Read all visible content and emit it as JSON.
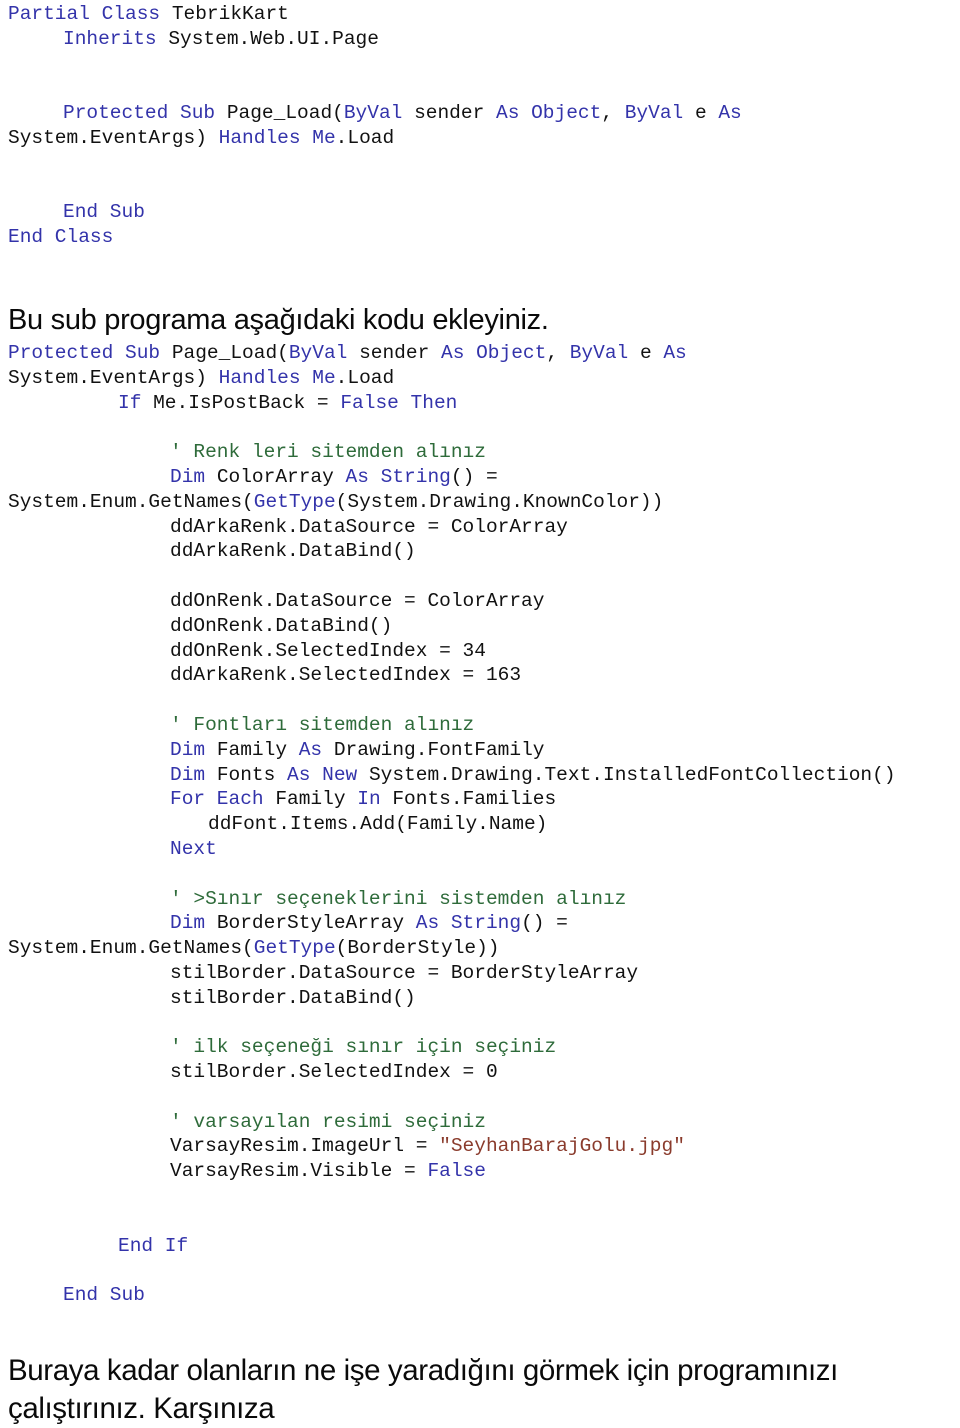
{
  "document": {
    "language": "tr",
    "colors": {
      "keyword": "#3333aa",
      "comment": "#2e6b3a",
      "string": "#8a3b2c",
      "plain": "#111111",
      "background": "#ffffff"
    }
  },
  "block_header": {
    "lines": [
      {
        "indent": 0,
        "parts": [
          {
            "t": "Partial Class ",
            "c": "kw"
          },
          {
            "t": "TebrikKart",
            "c": "pln"
          }
        ]
      },
      {
        "indent": 1,
        "parts": [
          {
            "t": "Inherits ",
            "c": "kw"
          },
          {
            "t": "System.Web.UI.Page",
            "c": "pln"
          }
        ]
      },
      {
        "indent": 0,
        "parts": []
      },
      {
        "indent": 0,
        "parts": []
      },
      {
        "indent": 1,
        "parts": [
          {
            "t": "Protected Sub ",
            "c": "kw"
          },
          {
            "t": "Page_Load(",
            "c": "pln"
          },
          {
            "t": "ByVal ",
            "c": "kw"
          },
          {
            "t": "sender ",
            "c": "pln"
          },
          {
            "t": "As Object",
            "c": "kw"
          },
          {
            "t": ", ",
            "c": "pln"
          },
          {
            "t": "ByVal ",
            "c": "kw"
          },
          {
            "t": "e ",
            "c": "pln"
          },
          {
            "t": "As",
            "c": "kw"
          }
        ]
      },
      {
        "indent": 0,
        "parts": [
          {
            "t": "System.EventArgs) ",
            "c": "pln"
          },
          {
            "t": "Handles Me",
            "c": "kw"
          },
          {
            "t": ".Load",
            "c": "pln"
          }
        ]
      },
      {
        "indent": 0,
        "parts": []
      },
      {
        "indent": 0,
        "parts": []
      },
      {
        "indent": 1,
        "parts": [
          {
            "t": "End Sub",
            "c": "kw"
          }
        ]
      },
      {
        "indent": 0,
        "parts": [
          {
            "t": "End Class",
            "c": "kw"
          }
        ]
      }
    ]
  },
  "heading": {
    "text": "Bu sub programa aşağıdaki kodu ekleyiniz."
  },
  "block_main": {
    "lines": [
      {
        "indent": 0,
        "parts": [
          {
            "t": "Protected Sub ",
            "c": "kw"
          },
          {
            "t": "Page_Load(",
            "c": "pln"
          },
          {
            "t": "ByVal ",
            "c": "kw"
          },
          {
            "t": "sender ",
            "c": "pln"
          },
          {
            "t": "As Object",
            "c": "kw"
          },
          {
            "t": ", ",
            "c": "pln"
          },
          {
            "t": "ByVal ",
            "c": "kw"
          },
          {
            "t": "e ",
            "c": "pln"
          },
          {
            "t": "As",
            "c": "kw"
          }
        ]
      },
      {
        "indent": 0,
        "parts": [
          {
            "t": "System.EventArgs) ",
            "c": "pln"
          },
          {
            "t": "Handles Me",
            "c": "kw"
          },
          {
            "t": ".Load",
            "c": "pln"
          }
        ]
      },
      {
        "indent": 2,
        "parts": [
          {
            "t": "If ",
            "c": "kw"
          },
          {
            "t": "Me.IsPostBack = ",
            "c": "pln"
          },
          {
            "t": "False Then",
            "c": "kw"
          }
        ]
      },
      {
        "indent": 0,
        "parts": []
      },
      {
        "indent": 3,
        "parts": [
          {
            "t": "' Renk leri sitemden alınız",
            "c": "cmt"
          }
        ]
      },
      {
        "indent": 3,
        "parts": [
          {
            "t": "Dim ",
            "c": "kw"
          },
          {
            "t": "ColorArray ",
            "c": "pln"
          },
          {
            "t": "As String",
            "c": "kw"
          },
          {
            "t": "() =",
            "c": "pln"
          }
        ]
      },
      {
        "indent": 0,
        "parts": [
          {
            "t": "System.Enum.GetNames(",
            "c": "pln"
          },
          {
            "t": "GetType",
            "c": "kw"
          },
          {
            "t": "(System.Drawing.KnownColor))",
            "c": "pln"
          }
        ]
      },
      {
        "indent": 3,
        "parts": [
          {
            "t": "ddArkaRenk.DataSource = ColorArray",
            "c": "pln"
          }
        ]
      },
      {
        "indent": 3,
        "parts": [
          {
            "t": "ddArkaRenk.DataBind()",
            "c": "pln"
          }
        ]
      },
      {
        "indent": 0,
        "parts": []
      },
      {
        "indent": 3,
        "parts": [
          {
            "t": "ddOnRenk.DataSource = ColorArray",
            "c": "pln"
          }
        ]
      },
      {
        "indent": 3,
        "parts": [
          {
            "t": "ddOnRenk.DataBind()",
            "c": "pln"
          }
        ]
      },
      {
        "indent": 3,
        "parts": [
          {
            "t": "ddOnRenk.SelectedIndex = 34",
            "c": "pln"
          }
        ]
      },
      {
        "indent": 3,
        "parts": [
          {
            "t": "ddArkaRenk.SelectedIndex = 163",
            "c": "pln"
          }
        ]
      },
      {
        "indent": 0,
        "parts": []
      },
      {
        "indent": 3,
        "parts": [
          {
            "t": "' Fontları sitemden alınız",
            "c": "cmt"
          }
        ]
      },
      {
        "indent": 3,
        "parts": [
          {
            "t": "Dim ",
            "c": "kw"
          },
          {
            "t": "Family ",
            "c": "pln"
          },
          {
            "t": "As ",
            "c": "kw"
          },
          {
            "t": "Drawing.FontFamily",
            "c": "pln"
          }
        ]
      },
      {
        "indent": 3,
        "parts": [
          {
            "t": "Dim ",
            "c": "kw"
          },
          {
            "t": "Fonts ",
            "c": "pln"
          },
          {
            "t": "As New ",
            "c": "kw"
          },
          {
            "t": "System.Drawing.Text.InstalledFontCollection()",
            "c": "pln"
          }
        ]
      },
      {
        "indent": 3,
        "parts": [
          {
            "t": "For Each ",
            "c": "kw"
          },
          {
            "t": "Family ",
            "c": "pln"
          },
          {
            "t": "In ",
            "c": "kw"
          },
          {
            "t": "Fonts.Families",
            "c": "pln"
          }
        ]
      },
      {
        "indent": 4,
        "parts": [
          {
            "t": "ddFont.Items.Add(Family.Name)",
            "c": "pln"
          }
        ]
      },
      {
        "indent": 3,
        "parts": [
          {
            "t": "Next",
            "c": "kw"
          }
        ]
      },
      {
        "indent": 0,
        "parts": []
      },
      {
        "indent": 3,
        "parts": [
          {
            "t": "' >Sınır seçeneklerini sistemden alınız",
            "c": "cmt"
          }
        ]
      },
      {
        "indent": 3,
        "parts": [
          {
            "t": "Dim ",
            "c": "kw"
          },
          {
            "t": "BorderStyleArray ",
            "c": "pln"
          },
          {
            "t": "As String",
            "c": "kw"
          },
          {
            "t": "() =",
            "c": "pln"
          }
        ]
      },
      {
        "indent": 0,
        "parts": [
          {
            "t": "System.Enum.GetNames(",
            "c": "pln"
          },
          {
            "t": "GetType",
            "c": "kw"
          },
          {
            "t": "(BorderStyle))",
            "c": "pln"
          }
        ]
      },
      {
        "indent": 3,
        "parts": [
          {
            "t": "stilBorder.DataSource = BorderStyleArray",
            "c": "pln"
          }
        ]
      },
      {
        "indent": 3,
        "parts": [
          {
            "t": "stilBorder.DataBind()",
            "c": "pln"
          }
        ]
      },
      {
        "indent": 0,
        "parts": []
      },
      {
        "indent": 3,
        "parts": [
          {
            "t": "' ilk seçeneği sınır için seçiniz",
            "c": "cmt"
          }
        ]
      },
      {
        "indent": 3,
        "parts": [
          {
            "t": "stilBorder.SelectedIndex = 0",
            "c": "pln"
          }
        ]
      },
      {
        "indent": 0,
        "parts": []
      },
      {
        "indent": 3,
        "parts": [
          {
            "t": "' varsayılan resimi seçiniz",
            "c": "cmt"
          }
        ]
      },
      {
        "indent": 3,
        "parts": [
          {
            "t": "VarsayResim.ImageUrl = ",
            "c": "pln"
          },
          {
            "t": "\"SeyhanBarajGolu.jpg\"",
            "c": "str"
          }
        ]
      },
      {
        "indent": 3,
        "parts": [
          {
            "t": "VarsayResim.Visible = ",
            "c": "pln"
          },
          {
            "t": "False",
            "c": "kw"
          }
        ]
      },
      {
        "indent": 0,
        "parts": []
      },
      {
        "indent": 0,
        "parts": []
      },
      {
        "indent": 2,
        "parts": [
          {
            "t": "End If",
            "c": "kw"
          }
        ]
      },
      {
        "indent": 0,
        "parts": []
      },
      {
        "indent": 1,
        "parts": [
          {
            "t": "End Sub",
            "c": "kw"
          }
        ]
      }
    ]
  },
  "bottom_paragraph": {
    "text": "Buraya kadar olanların ne işe yaradığını görmek için  programınızı çalıştırınız. Karşınıza"
  }
}
